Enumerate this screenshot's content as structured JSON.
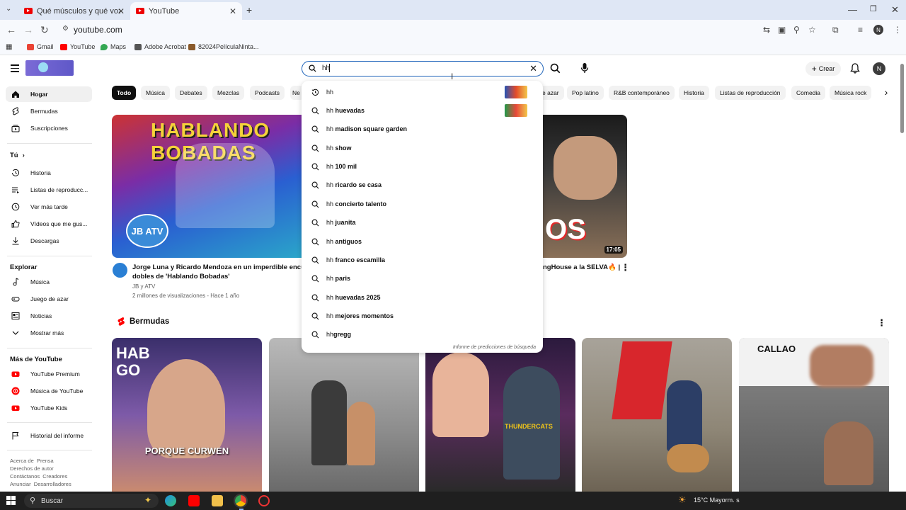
{
  "browser": {
    "tabs": [
      {
        "title": "Qué músculos y qué voz 😠 #...",
        "active": false
      },
      {
        "title": "YouTube",
        "active": true
      }
    ],
    "new_tab": "+",
    "url": "youtube.com",
    "bookmarks": [
      "Gmail",
      "YouTube",
      "Maps",
      "Adobe Acrobat",
      "82024PelículaNinta..."
    ]
  },
  "header": {
    "search_value": "hh",
    "crear_label": "Crear",
    "avatar_letter": "N"
  },
  "sidebar": {
    "main": [
      {
        "label": "Hogar",
        "icon": "home-icon",
        "active": true
      },
      {
        "label": "Bermudas",
        "icon": "shorts-icon"
      },
      {
        "label": "Suscripciones",
        "icon": "subscriptions-icon"
      }
    ],
    "you_heading": "Tú",
    "you": [
      {
        "label": "Historia",
        "icon": "history-icon"
      },
      {
        "label": "Listas de reproducc...",
        "icon": "playlists-icon"
      },
      {
        "label": "Ver más tarde",
        "icon": "watch-later-icon"
      },
      {
        "label": "Vídeos que me gus...",
        "icon": "like-icon"
      },
      {
        "label": "Descargas",
        "icon": "download-icon"
      }
    ],
    "explore_heading": "Explorar",
    "explore": [
      {
        "label": "Música",
        "icon": "music-icon"
      },
      {
        "label": "Juego de azar",
        "icon": "gaming-icon"
      },
      {
        "label": "Noticias",
        "icon": "news-icon"
      },
      {
        "label": "Mostrar más",
        "icon": "chevron-down-icon"
      }
    ],
    "more_heading": "Más de YouTube",
    "more": [
      {
        "label": "YouTube Premium",
        "icon": "youtube-premium-icon"
      },
      {
        "label": "Música de YouTube",
        "icon": "youtube-music-icon"
      },
      {
        "label": "YouTube Kids",
        "icon": "youtube-kids-icon"
      }
    ],
    "report_history": "Historial del informe",
    "footer": [
      "Acerca de",
      "Prensa",
      "Derechos de autor",
      "Contáctanos",
      "Creadores",
      "Anunciar",
      "Desarrolladores"
    ]
  },
  "chips": [
    "Todo",
    "Música",
    "Debates",
    "Mezclas",
    "Podcasts",
    "Ne",
    "e azar",
    "Pop latino",
    "R&B contemporáneo",
    "Historia",
    "Listas de reproducción",
    "Comedia",
    "Música rock"
  ],
  "videos": [
    {
      "title_line1": "Jorge Luna y Ricardo Mendoza en un imperdible encuen",
      "title_line2": "dobles de 'Hablando Bobadas'",
      "channel": "JB y ATV",
      "meta": "2 millones de visualizaciones - Hace 1 año"
    },
    {
      "title_fragment": "ngHouse a la SELVA🔥 |",
      "duration": "17:05"
    }
  ],
  "thumb_text": {
    "v1_banner": "HABLANDO BOBADAS",
    "v1_logo": "JB ATV",
    "v2_text": "OS"
  },
  "suggestions": [
    {
      "prefix": "hh",
      "rest": "",
      "icon": "history-icon"
    },
    {
      "prefix": "hh",
      "rest": " huevadas",
      "icon": "search-icon"
    },
    {
      "prefix": "hh",
      "rest": " madison square garden",
      "icon": "search-icon"
    },
    {
      "prefix": "hh",
      "rest": " show",
      "icon": "search-icon"
    },
    {
      "prefix": "hh",
      "rest": " 100 mil",
      "icon": "search-icon"
    },
    {
      "prefix": "hh",
      "rest": " ricardo se casa",
      "icon": "search-icon"
    },
    {
      "prefix": "hh",
      "rest": " concierto talento",
      "icon": "search-icon"
    },
    {
      "prefix": "hh",
      "rest": " juanita",
      "icon": "search-icon"
    },
    {
      "prefix": "hh",
      "rest": " antiguos",
      "icon": "search-icon"
    },
    {
      "prefix": "hh",
      "rest": " franco escamilla",
      "icon": "search-icon"
    },
    {
      "prefix": "hh",
      "rest": " paris",
      "icon": "search-icon"
    },
    {
      "prefix": "hh",
      "rest": " huevadas 2025",
      "icon": "search-icon"
    },
    {
      "prefix": "hh",
      "rest": " mejores momentos",
      "icon": "search-icon"
    },
    {
      "prefix": "hh",
      "rest": "gregg",
      "icon": "search-icon"
    }
  ],
  "suggest_report": "Informe de predicciones de búsqueda",
  "shorts_heading": "Bermudas",
  "shorts": [
    {
      "overlay": "HAB GO",
      "caption": "PORQUE CURWEN"
    },
    {
      "overlay": "",
      "caption": ""
    },
    {
      "overlay": "THUNDERCATS",
      "caption": ""
    },
    {
      "overlay": "",
      "caption": ""
    },
    {
      "overlay": "CALLAO",
      "caption": ""
    }
  ],
  "taskbar": {
    "search_placeholder": "Buscar",
    "weather": "15°C  Mayorm. s"
  },
  "colors": {
    "accent": "#1c62b9",
    "youtube_red": "#ff0000"
  }
}
